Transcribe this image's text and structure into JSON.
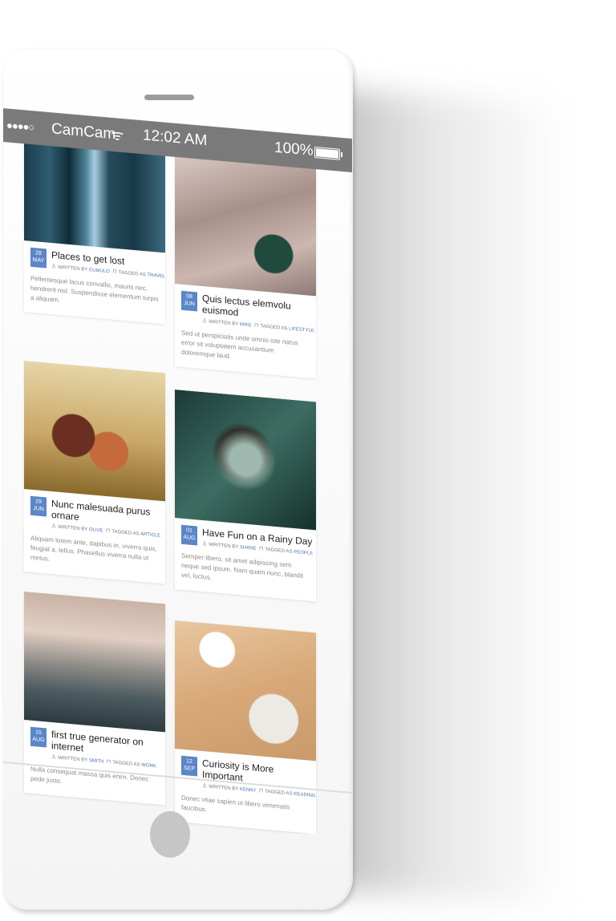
{
  "status_bar": {
    "signal": "●●●●○",
    "carrier": "CamCam",
    "wifi_icon": "wifi-icon",
    "time": "12:02 AM",
    "battery": "100%"
  },
  "posts": [
    {
      "day": "28",
      "month": "MAY",
      "title": "Places to get lost",
      "written_by": "WRITTEN BY",
      "author": "CUMULO",
      "tagged_as": "TAGGED AS",
      "tag": "TRAVEL",
      "excerpt": "Pellentesque lacus convallis, mauris nec, hendrerit nisl. Suspendisse elementum turpis a aliquam."
    },
    {
      "day": "08",
      "month": "JUN",
      "title": "Quis lectus elemvolu euismod",
      "written_by": "WRITTEN BY",
      "author": "MIKE",
      "tagged_as": "TAGGED AS",
      "tag": "LIFESTYLE",
      "excerpt": "Sed ut perspiciatis unde omnis iste natus error sit voluptatem accusantium doloremque laud."
    },
    {
      "day": "29",
      "month": "JUN",
      "title": "Nunc malesuada purus ornare",
      "written_by": "WRITTEN BY",
      "author": "OLIVE",
      "tagged_as": "TAGGED AS",
      "tag": "ARTICLE",
      "excerpt": "Aliquam lorem ante, dapibus in, viverra quis, feugiat a, tellus. Phasellus viverra nulla ut metus."
    },
    {
      "day": "01",
      "month": "AUG",
      "title": "Have Fun on a Rainy Day",
      "written_by": "WRITTEN BY",
      "author": "SHANE",
      "tagged_as": "TAGGED AS",
      "tag": "PEOPLE",
      "excerpt": "Semper libero, sit amet adipiscing sem neque sed ipsum. Nam quam nunc, blandit vel, luctus."
    },
    {
      "day": "15",
      "month": "AUG",
      "title": "first true generator on internet",
      "written_by": "WRITTEN BY",
      "author": "SMITH",
      "tagged_as": "TAGGED AS",
      "tag": "WORK",
      "excerpt": "Nulla consequat massa quis enim. Donec pede justo."
    },
    {
      "day": "12",
      "month": "SEP",
      "title": "Curiosity is More Important",
      "written_by": "WRITTEN BY",
      "author": "KENNY",
      "tagged_as": "TAGGED AS",
      "tag": "READING",
      "excerpt": "Donec vitae sapien ut libero venenatis faucibus."
    }
  ]
}
